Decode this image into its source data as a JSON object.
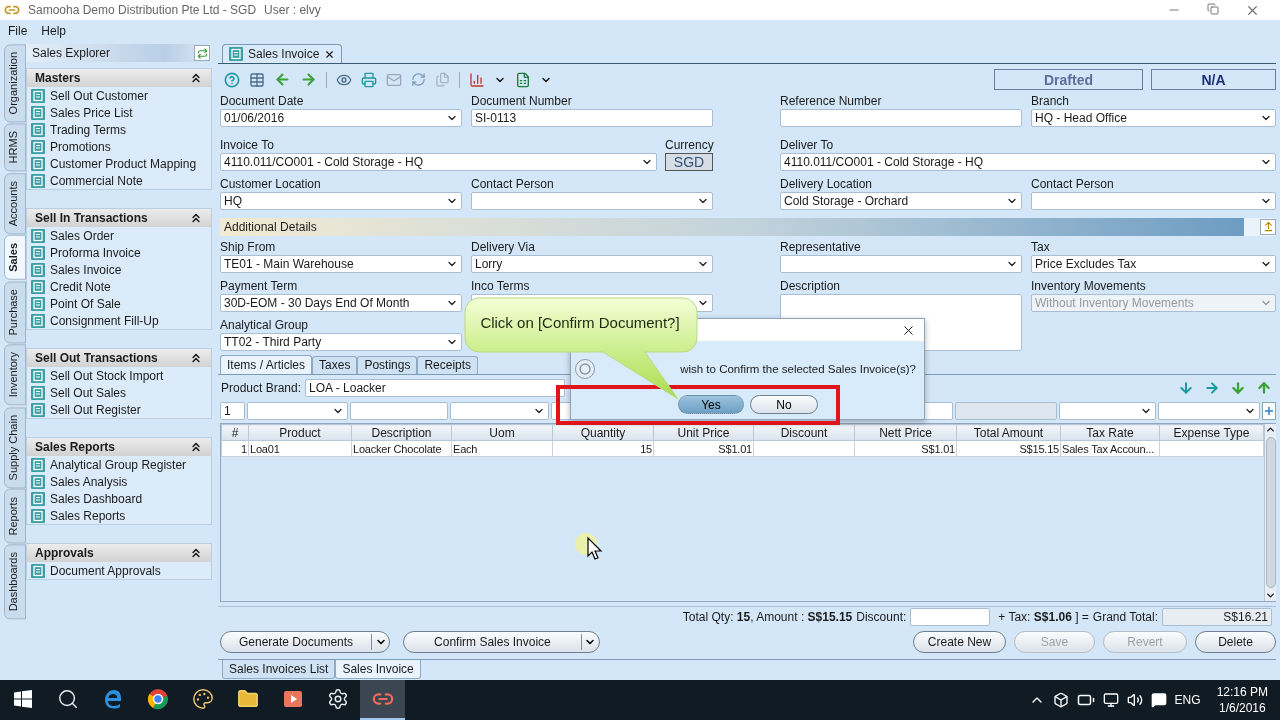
{
  "window": {
    "title": "Samooha Demo Distribution Pte Ltd - SGD",
    "user": "User : elvy"
  },
  "menu": [
    {
      "label": "File"
    },
    {
      "label": "Help"
    }
  ],
  "side_tabs": [
    {
      "label": "Organization",
      "selected": false
    },
    {
      "label": "HRMS",
      "selected": false
    },
    {
      "label": "Accounts",
      "selected": false
    },
    {
      "label": "Sales",
      "selected": true
    },
    {
      "label": "Purchase",
      "selected": false
    },
    {
      "label": "Inventory",
      "selected": false
    },
    {
      "label": "Supply Chain",
      "selected": false
    },
    {
      "label": "Reports",
      "selected": false
    },
    {
      "label": "Dashboards",
      "selected": false
    }
  ],
  "explorer": {
    "title": "Sales Explorer",
    "groups": [
      {
        "title": "Masters",
        "items": [
          {
            "label": "Sell Out Customer"
          },
          {
            "label": "Sales Price List"
          },
          {
            "label": "Trading Terms"
          },
          {
            "label": "Promotions"
          },
          {
            "label": "Customer Product Mapping"
          },
          {
            "label": "Commercial Note"
          }
        ]
      },
      {
        "title": "Sell In Transactions",
        "items": [
          {
            "label": "Sales Order"
          },
          {
            "label": "Proforma Invoice"
          },
          {
            "label": "Sales Invoice"
          },
          {
            "label": "Credit Note"
          },
          {
            "label": "Point Of Sale"
          },
          {
            "label": "Consignment Fill-Up"
          }
        ]
      },
      {
        "title": "Sell Out Transactions",
        "items": [
          {
            "label": "Sell Out Stock Import"
          },
          {
            "label": "Sell Out Sales"
          },
          {
            "label": "Sell Out Register"
          }
        ]
      },
      {
        "title": "Sales Reports",
        "items": [
          {
            "label": "Analytical Group Register"
          },
          {
            "label": "Sales Analysis"
          },
          {
            "label": "Sales Dashboard"
          },
          {
            "label": "Sales Reports"
          }
        ]
      },
      {
        "title": "Approvals",
        "items": [
          {
            "label": "Document Approvals"
          }
        ]
      }
    ]
  },
  "document_tab": {
    "label": "Sales Invoice"
  },
  "status": [
    "Drafted",
    "N/A"
  ],
  "header": {
    "document_date": {
      "label": "Document Date",
      "value": "01/06/2016"
    },
    "document_number": {
      "label": "Document Number",
      "value": "SI-0113"
    },
    "reference_number": {
      "label": "Reference Number"
    },
    "branch": {
      "label": "Branch",
      "value": "HQ - Head Office"
    },
    "invoice_to": {
      "label": "Invoice To",
      "value": "4110.011/CO001 - Cold Storage - HQ"
    },
    "currency": {
      "label": "Currency",
      "value": "SGD"
    },
    "deliver_to": {
      "label": "Deliver To",
      "value": "4110.011/CO001 - Cold Storage - HQ"
    },
    "customer_location": {
      "label": "Customer Location",
      "value": "HQ"
    },
    "contact_person": {
      "label": "Contact Person"
    },
    "delivery_location": {
      "label": "Delivery Location",
      "value": "Cold Storage - Orchard"
    },
    "delivery_contact_person": {
      "label": "Contact Person"
    }
  },
  "additional_details": {
    "title": "Additional Details",
    "ship_from": {
      "label": "Ship From",
      "value": "TE01 - Main Warehouse"
    },
    "delivery_via": {
      "label": "Delivery Via",
      "value": "Lorry"
    },
    "representative": {
      "label": "Representative"
    },
    "tax": {
      "label": "Tax",
      "value": "Price Excludes Tax"
    },
    "payment_term": {
      "label": "Payment Term",
      "value": "30D-EOM - 30 Days End Of Month"
    },
    "inco_terms": {
      "label": "Inco Terms"
    },
    "description": {
      "label": "Description"
    },
    "inventory_movements": {
      "label": "Inventory Movements",
      "value": "Without Inventory Movements",
      "disabled": true
    },
    "analytical_group": {
      "label": "Analytical Group",
      "value": "TT02 - Third Party"
    }
  },
  "detail_tabs": [
    {
      "label": "Items / Articles",
      "selected": true
    },
    {
      "label": "Taxes",
      "selected": false
    },
    {
      "label": "Postings",
      "selected": false
    },
    {
      "label": "Receipts",
      "selected": false
    }
  ],
  "product_brand": {
    "label": "Product Brand:",
    "value": "LOA - Loacker"
  },
  "filter_row": {
    "value": "1"
  },
  "table": {
    "columns": [
      "#",
      "Product",
      "Description",
      "Uom",
      "Quantity",
      "Unit Price",
      "Discount",
      "Nett Price",
      "Total Amount",
      "Tax Rate",
      "Expense Type"
    ],
    "rows": [
      [
        "1",
        "Loa01",
        "Loacker Chocolate",
        "Each",
        "15",
        "S$1.01",
        "",
        "S$1.01",
        "S$15.15",
        "Sales Tax Accoun...",
        ""
      ]
    ]
  },
  "totals": {
    "summary": "Total Qty: **15**, Amount : **S$15.15**",
    "discount_label": "Discount:",
    "tax": "+ Tax: **S$1.06** ] =",
    "grand_total_label": "Grand Total:",
    "grand_total": "S$16.21"
  },
  "split_buttons": [
    {
      "label": "Generate Documents"
    },
    {
      "label": "Confirm Sales Invoice"
    }
  ],
  "actions": [
    {
      "label": "Create New",
      "disabled": false
    },
    {
      "label": "Save",
      "disabled": true
    },
    {
      "label": "Revert",
      "disabled": true
    },
    {
      "label": "Delete",
      "disabled": false
    }
  ],
  "bottom_tabs": [
    {
      "label": "Sales Invoices List",
      "selected": false
    },
    {
      "label": "Sales Invoice",
      "selected": true
    }
  ],
  "dialog": {
    "message": "wish to Confirm the selected Sales Invoice(s)?",
    "buttons": [
      {
        "label": "Yes",
        "selected": true
      },
      {
        "label": "No",
        "selected": false
      }
    ]
  },
  "callout": {
    "text": "Click on [Confirm Document?]"
  },
  "taskbar": {
    "apps": [
      {
        "kind": "start",
        "active": false
      },
      {
        "kind": "search",
        "active": false
      },
      {
        "kind": "browser",
        "active": false
      },
      {
        "kind": "globe",
        "active": false
      },
      {
        "kind": "paint",
        "active": false
      },
      {
        "kind": "folder",
        "active": false
      },
      {
        "kind": "media",
        "active": false
      },
      {
        "kind": "settings",
        "active": false
      },
      {
        "kind": "link",
        "active": true
      }
    ],
    "language": "ENG",
    "time": "12:16 PM",
    "date": "1/6/2016"
  }
}
